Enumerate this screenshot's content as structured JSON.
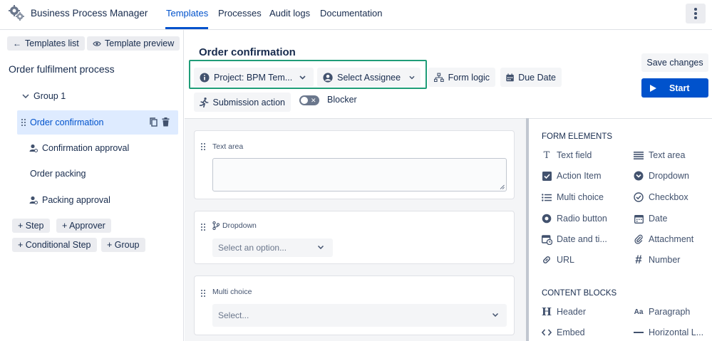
{
  "app": {
    "title": "Business Process Manager"
  },
  "nav": {
    "tabs": [
      "Templates",
      "Processes",
      "Audit logs",
      "Documentation"
    ],
    "active_tab": "Templates"
  },
  "sidebar": {
    "templates_list_label": "Templates list",
    "template_preview_label": "Template preview",
    "process_title": "Order fulfilment process",
    "group_label": "Group 1",
    "steps": [
      {
        "label": "Order confirmation",
        "selected": true
      },
      {
        "label": "Confirmation approval",
        "type": "approver"
      },
      {
        "label": "Order packing"
      },
      {
        "label": "Packing approval",
        "type": "approver"
      }
    ],
    "add_buttons": [
      "+ Step",
      "+ Approver",
      "+ Conditional Step",
      "+ Group"
    ]
  },
  "step_editor": {
    "title": "Order confirmation",
    "project_label": "Project: BPM Tem...",
    "assignee_label": "Select Assignee",
    "form_logic_label": "Form logic",
    "due_date_label": "Due Date",
    "submission_action_label": "Submission action",
    "blocker_label": "Blocker",
    "blocker_enabled": false,
    "save_label": "Save changes",
    "start_label": "Start"
  },
  "form_fields": [
    {
      "label": "Text area",
      "type": "textarea"
    },
    {
      "label": "Dropdown",
      "type": "dropdown",
      "placeholder": "Select an option..."
    },
    {
      "label": "Multi choice",
      "type": "multiselect",
      "placeholder": "Select..."
    }
  ],
  "panel": {
    "form_elements_heading": "FORM ELEMENTS",
    "form_elements": [
      {
        "label": "Text field",
        "icon": "text-field-icon"
      },
      {
        "label": "Text area",
        "icon": "text-area-icon"
      },
      {
        "label": "Action Item",
        "icon": "checkbox-checked-icon"
      },
      {
        "label": "Dropdown",
        "icon": "dropdown-icon"
      },
      {
        "label": "Multi choice",
        "icon": "list-icon"
      },
      {
        "label": "Checkbox",
        "icon": "check-circle-icon"
      },
      {
        "label": "Radio button",
        "icon": "radio-icon"
      },
      {
        "label": "Date",
        "icon": "calendar-icon"
      },
      {
        "label": "Date and ti...",
        "icon": "calendar-clock-icon"
      },
      {
        "label": "Attachment",
        "icon": "paperclip-icon"
      },
      {
        "label": "URL",
        "icon": "link-icon"
      },
      {
        "label": "Number",
        "icon": "hash-icon"
      }
    ],
    "content_blocks_heading": "CONTENT BLOCKS",
    "content_blocks": [
      {
        "label": "Header",
        "icon": "header-icon"
      },
      {
        "label": "Paragraph",
        "icon": "paragraph-icon"
      },
      {
        "label": "Embed",
        "icon": "code-icon"
      },
      {
        "label": "Horizontal L...",
        "icon": "horizontal-line-icon"
      }
    ]
  },
  "colors": {
    "accent": "#0052cc",
    "selected_bg": "#deebff",
    "highlight_border": "#1f9d78"
  }
}
